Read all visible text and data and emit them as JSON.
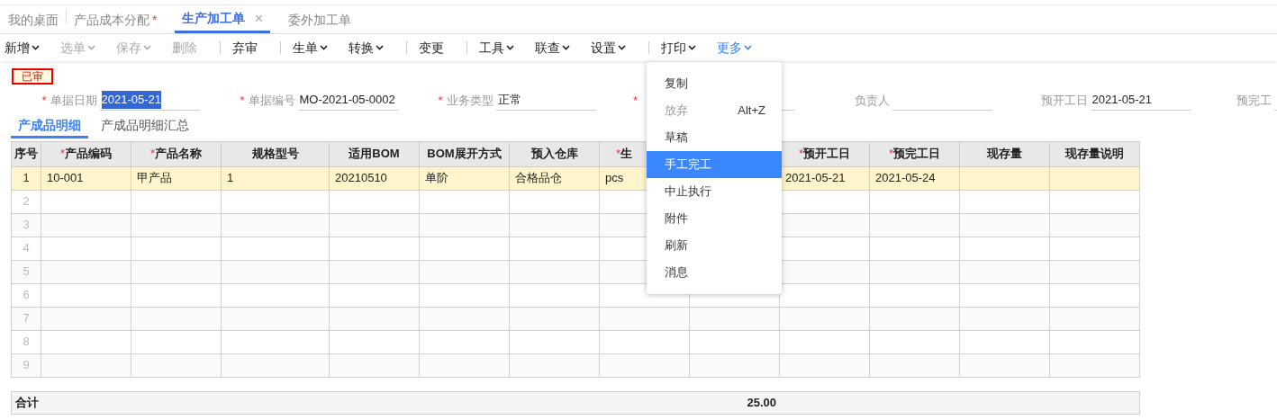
{
  "tabs": [
    {
      "label": "我的桌面",
      "selected": false
    },
    {
      "label": "产品成本分配",
      "marker": "*",
      "selected": false
    },
    {
      "label": "生产加工单",
      "close_glyph": "×",
      "selected": true
    },
    {
      "label": "委外加工单",
      "selected": false
    }
  ],
  "toolbar": [
    {
      "kind": "button",
      "label": "新增",
      "dropdown": true,
      "disabled": false,
      "selected": false
    },
    {
      "kind": "button",
      "label": "选单",
      "dropdown": true,
      "disabled": true,
      "selected": false
    },
    {
      "kind": "button",
      "label": "保存",
      "dropdown": true,
      "disabled": true,
      "selected": false
    },
    {
      "kind": "button",
      "label": "删除",
      "dropdown": false,
      "disabled": true,
      "selected": false
    },
    {
      "kind": "separator"
    },
    {
      "kind": "button",
      "label": "弃审",
      "dropdown": false,
      "disabled": false,
      "selected": false
    },
    {
      "kind": "separator"
    },
    {
      "kind": "button",
      "label": "生单",
      "dropdown": true,
      "disabled": false,
      "selected": false
    },
    {
      "kind": "button",
      "label": "转换",
      "dropdown": true,
      "disabled": false,
      "selected": false
    },
    {
      "kind": "separator"
    },
    {
      "kind": "button",
      "label": "变更",
      "dropdown": false,
      "disabled": false,
      "selected": false
    },
    {
      "kind": "separator"
    },
    {
      "kind": "button",
      "label": "工具",
      "dropdown": true,
      "disabled": false,
      "selected": false
    },
    {
      "kind": "button",
      "label": "联查",
      "dropdown": true,
      "disabled": false,
      "selected": false
    },
    {
      "kind": "button",
      "label": "设置",
      "dropdown": true,
      "disabled": false,
      "selected": false
    },
    {
      "kind": "separator"
    },
    {
      "kind": "button",
      "label": "打印",
      "dropdown": true,
      "disabled": false,
      "selected": false
    },
    {
      "kind": "button",
      "label": "更多",
      "dropdown": true,
      "disabled": false,
      "selected": true
    }
  ],
  "status_stamp": "已审",
  "form_fields": [
    {
      "mark": "*",
      "label": "单据日期",
      "value": "2021-05-21",
      "highlighted": true
    },
    {
      "mark": "*",
      "label": "单据编号",
      "value": "MO-2021-05-0002",
      "highlighted": false
    },
    {
      "mark": "*",
      "label": "业务类型",
      "value": "正常",
      "highlighted": false
    },
    {
      "mark": "*"
    },
    {
      "label": "负责人"
    },
    {
      "label": "预开工日",
      "value": "2021-05-21",
      "highlighted": false
    },
    {
      "label": "预完工"
    }
  ],
  "sub_tabs": [
    {
      "label": "产成品明细",
      "selected": true
    },
    {
      "label": "产成品明细汇总",
      "selected": false
    }
  ],
  "table": {
    "columns": [
      {
        "label": "序号"
      },
      {
        "mark": "*",
        "label": "产品编码"
      },
      {
        "mark": "*",
        "label": "产品名称"
      },
      {
        "label": "规格型号"
      },
      {
        "label": "适用BOM"
      },
      {
        "label": "BOM展开方式"
      },
      {
        "label": "预入仓库"
      },
      {
        "mark": "*",
        "label": "生"
      },
      {},
      {
        "mark": "*",
        "label": "预开工日"
      },
      {
        "mark": "*",
        "label": "预完工日"
      },
      {
        "label": "现存量"
      },
      {
        "label": "现存量说明"
      }
    ],
    "rows": [
      {
        "selected": true,
        "cells": [
          "1",
          "10-001",
          "甲产品",
          "1",
          "20210510",
          "单阶",
          "合格品仓",
          "pcs",
          null,
          "2021-05-21",
          "2021-05-24",
          null,
          null
        ]
      },
      {
        "selected": false,
        "cells": [
          "2"
        ]
      },
      {
        "selected": false,
        "cells": [
          "3"
        ]
      },
      {
        "selected": false,
        "cells": [
          "4"
        ]
      },
      {
        "selected": false,
        "cells": [
          "5"
        ]
      },
      {
        "selected": false,
        "cells": [
          "6"
        ]
      },
      {
        "selected": false,
        "cells": [
          "7"
        ]
      },
      {
        "selected": false,
        "cells": [
          "8"
        ]
      },
      {
        "selected": false,
        "cells": [
          "9"
        ]
      }
    ],
    "total": {
      "label": "合计",
      "value": "25.00"
    }
  },
  "dropdown_menu": [
    {
      "label": "复制",
      "disabled": false,
      "selected": false
    },
    {
      "label": "放弃",
      "shortcut": "Alt+Z",
      "disabled": true,
      "selected": false
    },
    {
      "label": "草稿",
      "disabled": false,
      "selected": false
    },
    {
      "label": "手工完工",
      "disabled": false,
      "selected": true
    },
    {
      "label": "中止执行",
      "disabled": false,
      "selected": false
    },
    {
      "label": "附件",
      "disabled": false,
      "selected": false
    },
    {
      "label": "刷新",
      "disabled": false,
      "selected": false
    },
    {
      "label": "消息",
      "disabled": false,
      "selected": false
    }
  ]
}
